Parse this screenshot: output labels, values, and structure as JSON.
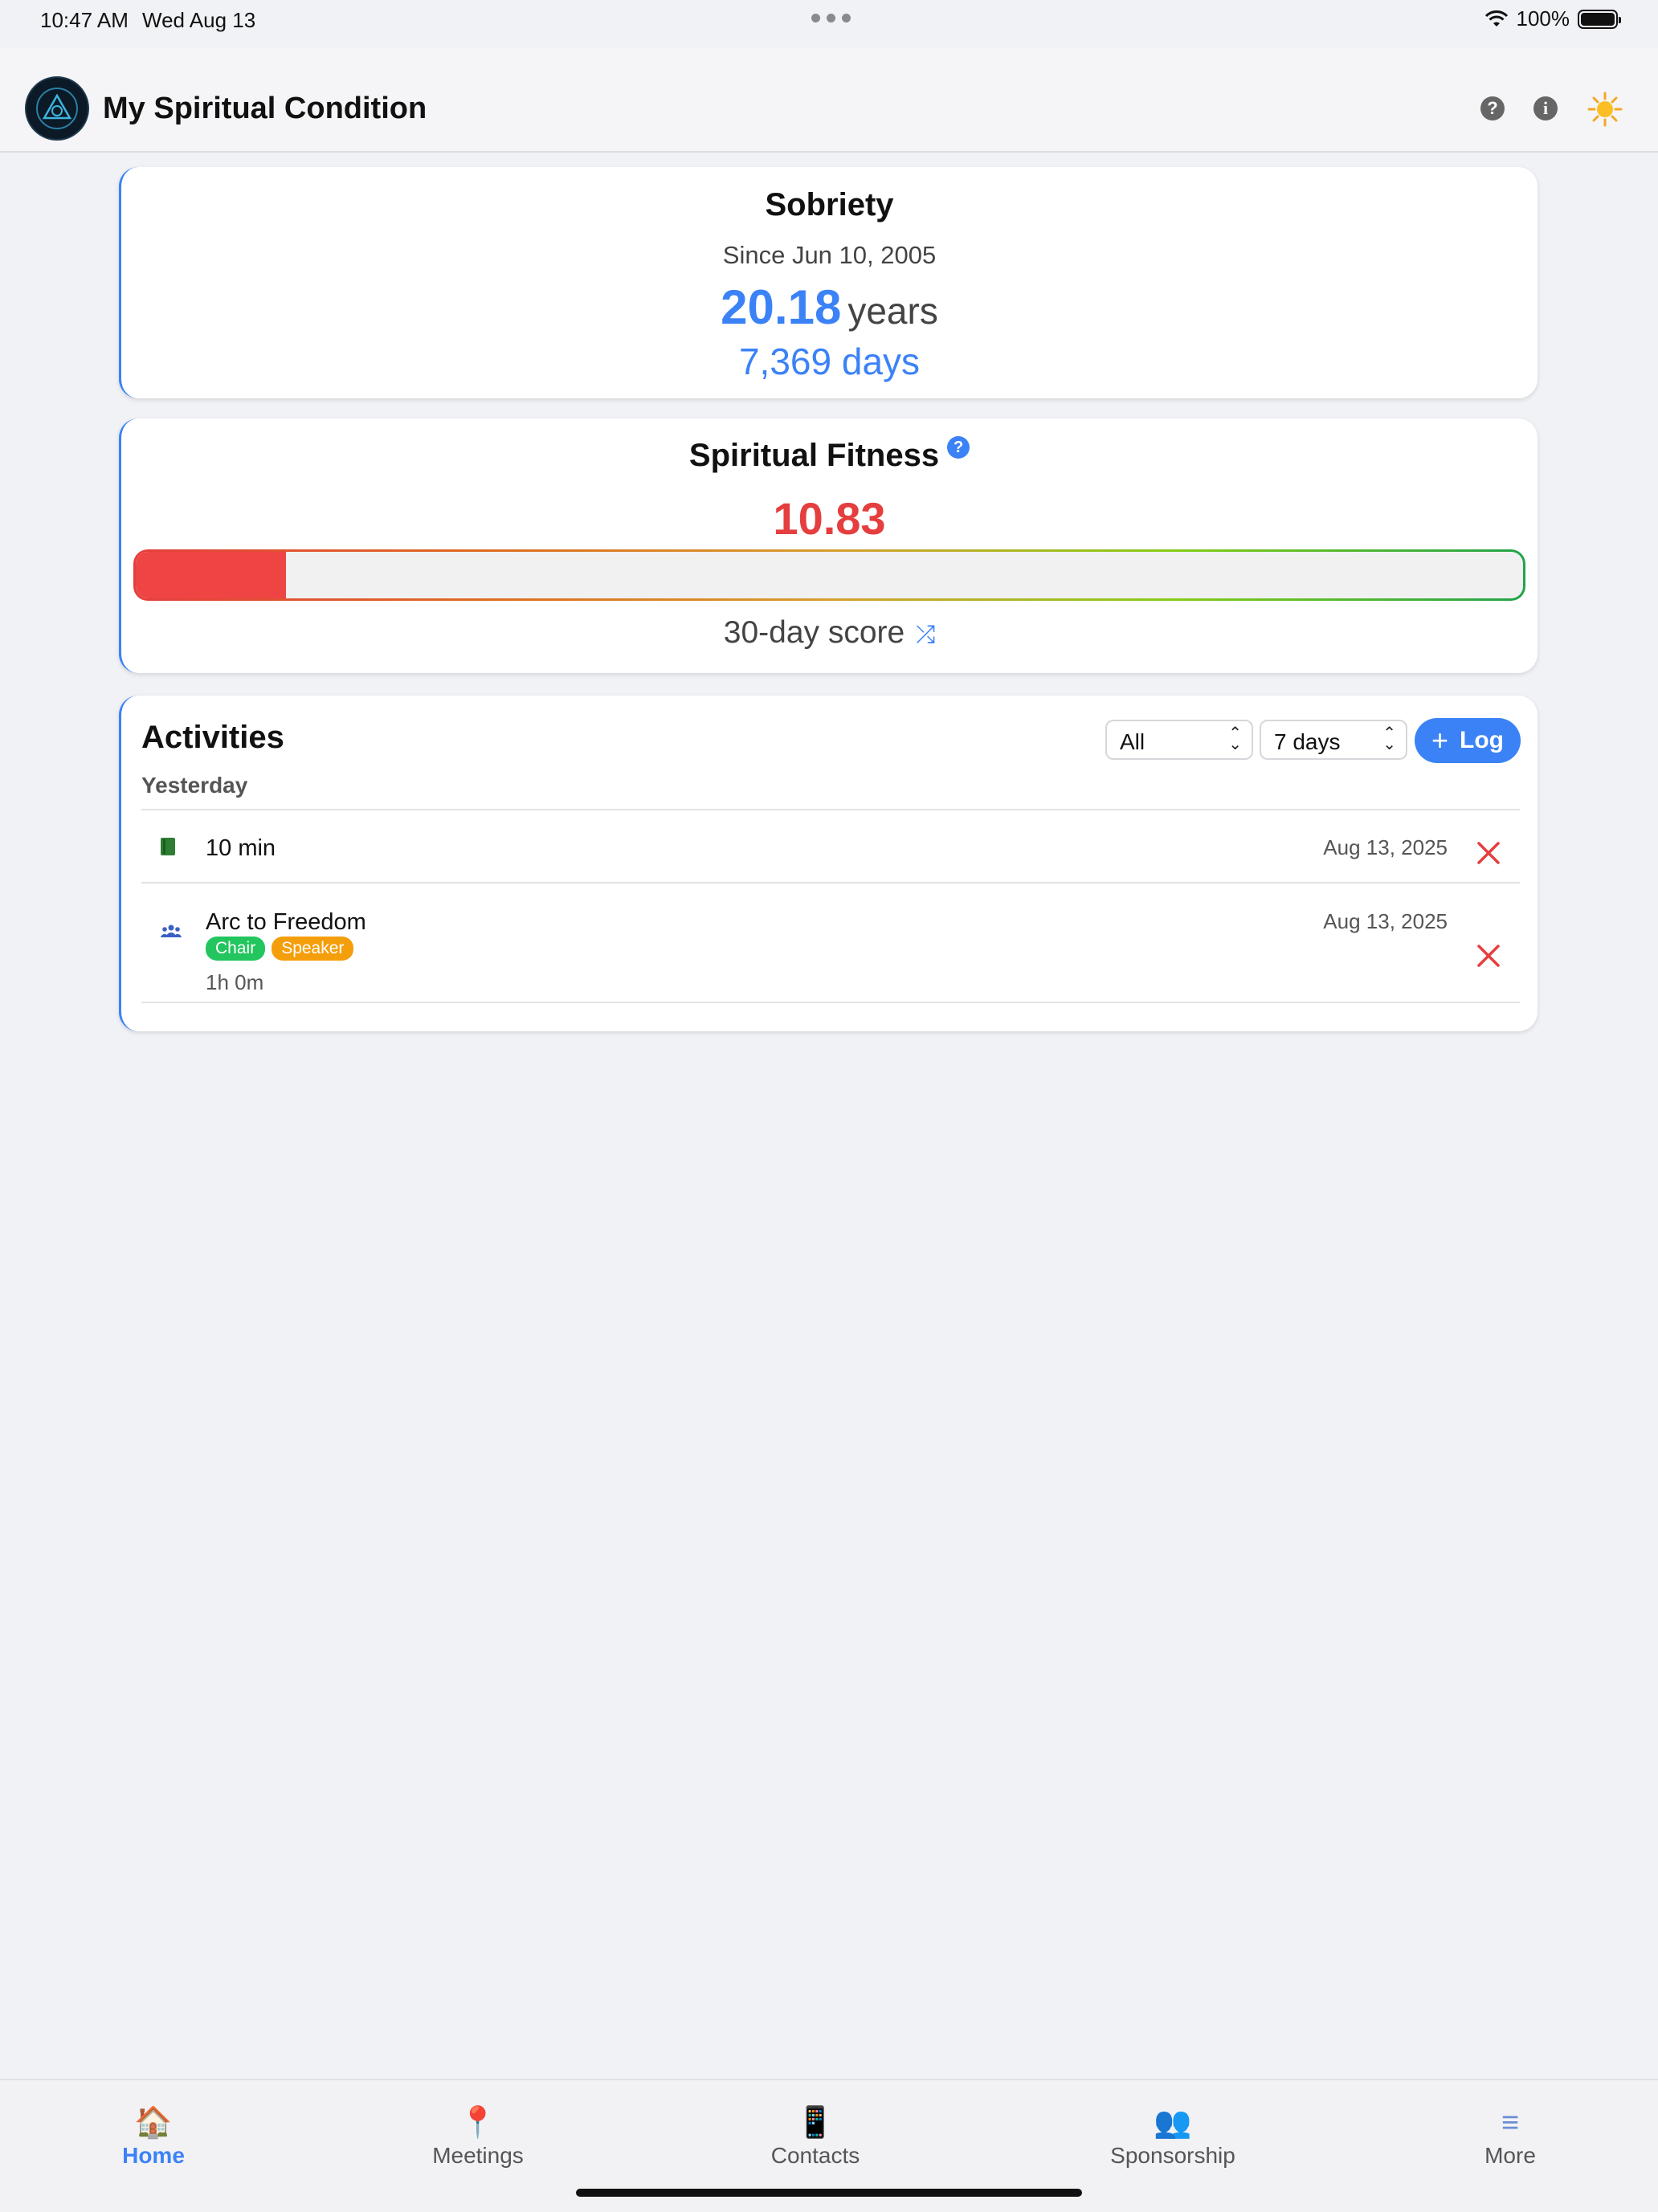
{
  "status_bar": {
    "time": "10:47 AM",
    "date": "Wed Aug 13",
    "battery": "100%"
  },
  "header": {
    "title": "My Spiritual Condition",
    "icons": [
      "help-icon",
      "info-icon",
      "sun-icon"
    ]
  },
  "sobriety": {
    "title": "Sobriety",
    "since": "Since Jun 10, 2005",
    "years_value": "20.18",
    "years_unit": "years",
    "days": "7,369 days"
  },
  "fitness": {
    "title": "Spiritual Fitness",
    "score": "10.83",
    "score_fraction": 0.1083,
    "caption": "30-day score",
    "color": "#e53e3e"
  },
  "activities": {
    "title": "Activities",
    "filter_type": "All",
    "filter_range": "7 days",
    "log_label": "Log",
    "group_label": "Yesterday",
    "items": [
      {
        "icon": "book-icon",
        "name": "10 min",
        "date": "Aug 13, 2025"
      },
      {
        "icon": "people-icon",
        "name": "Arc to Freedom",
        "date": "Aug 13, 2025",
        "tags": [
          "Chair",
          "Speaker"
        ],
        "duration": "1h 0m"
      }
    ]
  },
  "tabbar": {
    "items": [
      {
        "label": "Home",
        "icon": "house-icon",
        "active": true
      },
      {
        "label": "Meetings",
        "icon": "pin-icon",
        "active": false
      },
      {
        "label": "Contacts",
        "icon": "phone-icon",
        "active": false
      },
      {
        "label": "Sponsorship",
        "icon": "people-icon",
        "active": false
      },
      {
        "label": "More",
        "icon": "menu-icon",
        "active": false
      }
    ]
  },
  "colors": {
    "accent": "#3b82f6",
    "danger": "#e53e3e",
    "tag_green": "#22c55e",
    "tag_orange": "#f59e0b"
  }
}
